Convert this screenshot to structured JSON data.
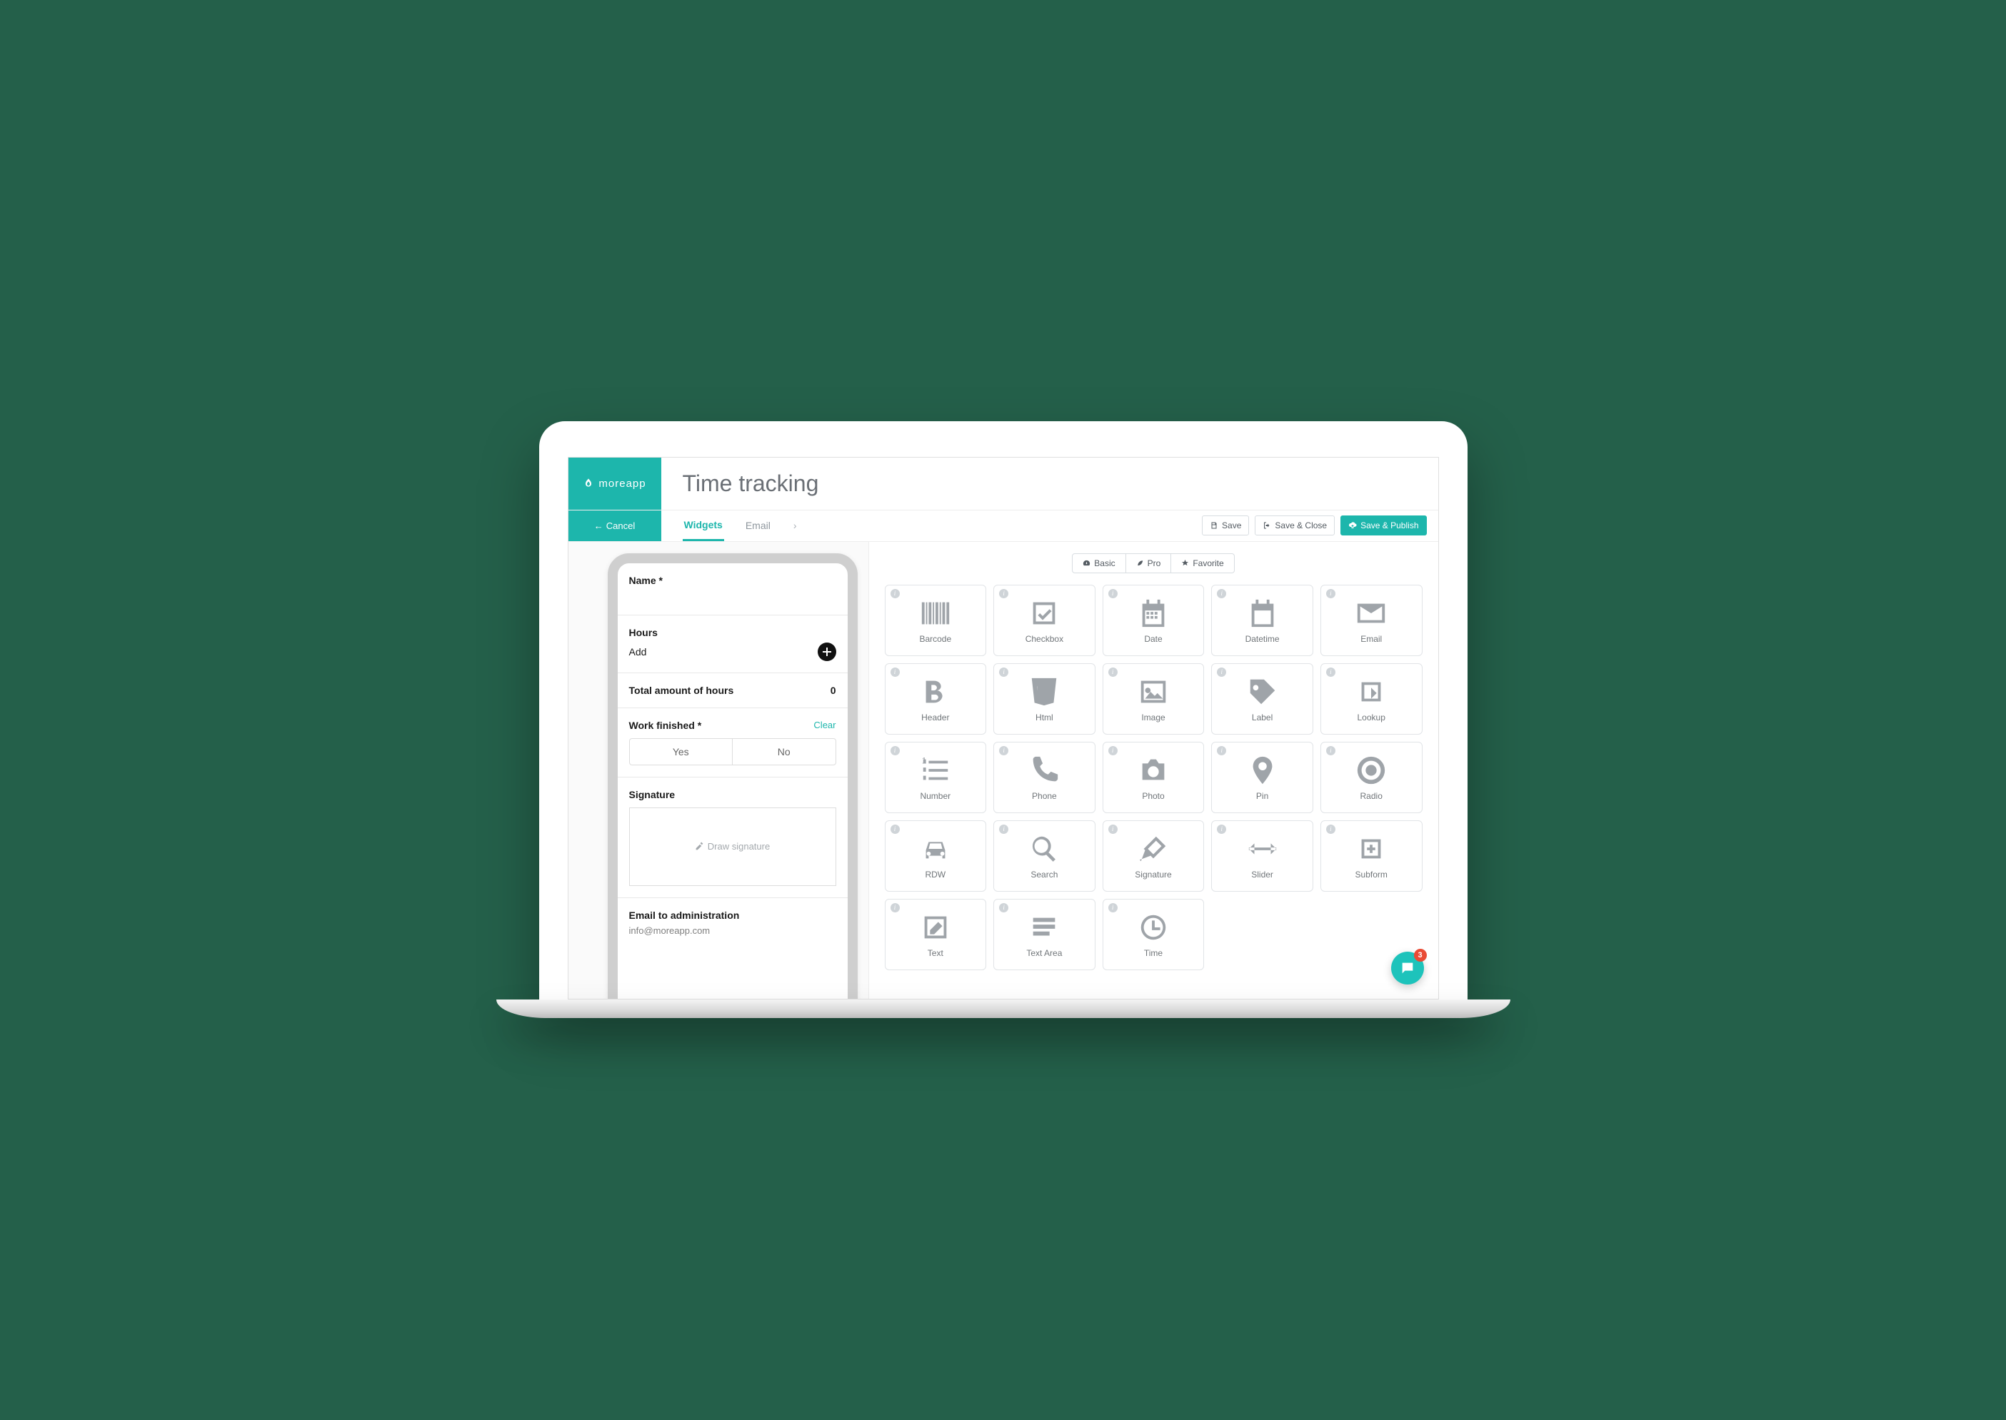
{
  "brand": "moreapp",
  "page_title": "Time tracking",
  "cancel_label": "Cancel",
  "tabs": {
    "widgets": "Widgets",
    "email": "Email"
  },
  "actions": {
    "save": "Save",
    "save_close": "Save & Close",
    "save_publish": "Save & Publish"
  },
  "filters": {
    "basic": "Basic",
    "pro": "Pro",
    "favorite": "Favorite"
  },
  "preview": {
    "name_label": "Name *",
    "hours_label": "Hours",
    "add_label": "Add",
    "total_label": "Total amount of hours",
    "total_value": "0",
    "finished_label": "Work finished *",
    "clear_label": "Clear",
    "yes": "Yes",
    "no": "No",
    "signature_label": "Signature",
    "signature_placeholder": "Draw signature",
    "email_admin_label": "Email to administration",
    "email_admin_value": "info@moreapp.com"
  },
  "widgets": [
    {
      "k": "barcode",
      "label": "Barcode"
    },
    {
      "k": "checkbox",
      "label": "Checkbox"
    },
    {
      "k": "date",
      "label": "Date"
    },
    {
      "k": "datetime",
      "label": "Datetime"
    },
    {
      "k": "email",
      "label": "Email"
    },
    {
      "k": "header",
      "label": "Header"
    },
    {
      "k": "html",
      "label": "Html"
    },
    {
      "k": "image",
      "label": "Image"
    },
    {
      "k": "label",
      "label": "Label"
    },
    {
      "k": "lookup",
      "label": "Lookup"
    },
    {
      "k": "number",
      "label": "Number"
    },
    {
      "k": "phone",
      "label": "Phone"
    },
    {
      "k": "photo",
      "label": "Photo"
    },
    {
      "k": "pin",
      "label": "Pin"
    },
    {
      "k": "radio",
      "label": "Radio"
    },
    {
      "k": "rdw",
      "label": "RDW"
    },
    {
      "k": "search",
      "label": "Search"
    },
    {
      "k": "signature",
      "label": "Signature"
    },
    {
      "k": "slider",
      "label": "Slider"
    },
    {
      "k": "subform",
      "label": "Subform"
    },
    {
      "k": "text",
      "label": "Text"
    },
    {
      "k": "textarea",
      "label": "Text Area"
    },
    {
      "k": "time",
      "label": "Time"
    }
  ],
  "chat_badge": "3"
}
